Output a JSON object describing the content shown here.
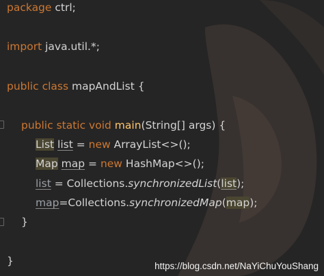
{
  "editor": {
    "lines": {
      "l1": {
        "kw": "package",
        "rest": " ctrl;"
      },
      "l2": {
        "kw": "import",
        "rest": " java.util.*;"
      },
      "l3": {
        "kw": "public class",
        "name": " mapAndList",
        "brace": " {"
      },
      "l4": {
        "kw": "public static void",
        "fn": " main",
        "rest": "(String[] args) {"
      },
      "l5": {
        "type": "List",
        "var": "list",
        "eq": " = ",
        "kw": "new",
        "rest": " ArrayList<>();"
      },
      "l6": {
        "type": "Map",
        "var": "map",
        "eq": " = ",
        "kw": "new",
        "rest": " HashMap<>();"
      },
      "l7": {
        "var": "list",
        "eq": " = Collections.",
        "method": "synchronizedList",
        "open": "(",
        "arg": "list",
        "close": ");"
      },
      "l8": {
        "var": "map",
        "eq": "=Collections.",
        "method": "synchronizedMap",
        "open": "(",
        "arg": "map",
        "close": ");"
      },
      "l9": {
        "brace": "}"
      },
      "l10": {
        "brace": "}"
      }
    },
    "colors": {
      "background": "#262525",
      "keyword": "#cc7832",
      "function": "#ffc66d",
      "text": "#d4d4d4"
    }
  },
  "watermark": {
    "text": "https://blog.csdn.net/NaYiChuYouShang"
  }
}
